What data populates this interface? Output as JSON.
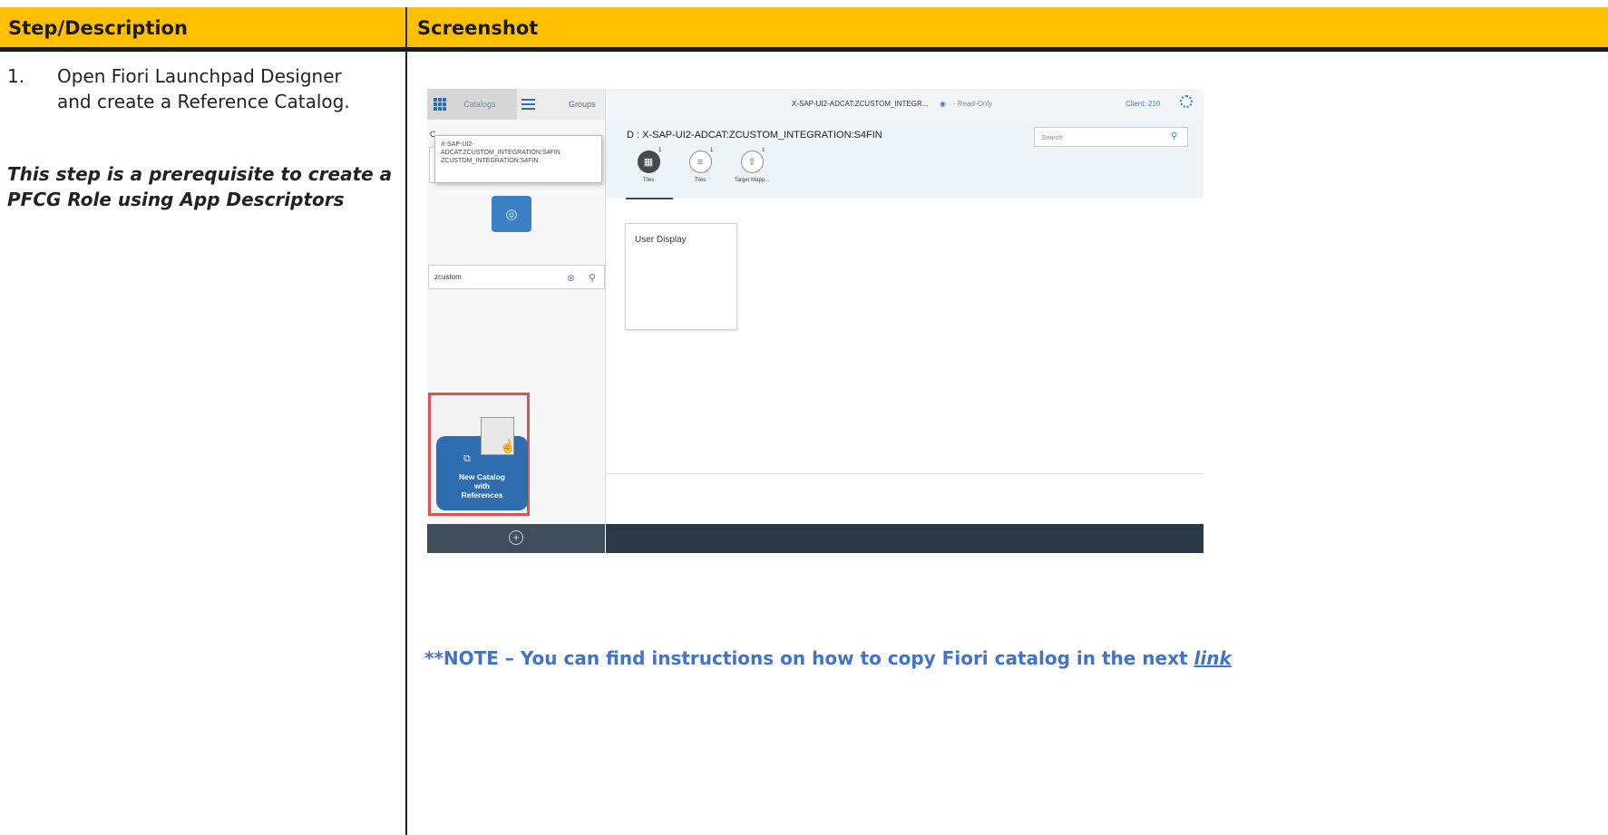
{
  "table": {
    "col1_header": "Step/Description",
    "col2_header": "Screenshot"
  },
  "step": {
    "number": "1.",
    "line1": "Open Fiori Launchpad Designer",
    "line2": "and create a Reference Catalog.",
    "prereq_line1": "This step is a prerequisite to create a",
    "prereq_line2": "PFCG Role using App Descriptors"
  },
  "note": {
    "text": "**NOTE – You can find instructions on how to copy Fiori catalog in the next ",
    "link_label": "link"
  },
  "screenshot": {
    "left_panel": {
      "catalogs_label": "Catalogs",
      "groups_label": "Groups",
      "c_label": "C",
      "tooltip_line1": "X-SAP-UI2-",
      "tooltip_line2": "ADCAT:ZCUSTOM_INTEGRATION:S4FIN",
      "tooltip_line3": "ZCUSTOM_INTEGRATION:S4FIN",
      "search_value": "zcustom",
      "new_catalog_label_1": "New Catalog",
      "new_catalog_label_2": "with",
      "new_catalog_label_3": "References"
    },
    "right_panel": {
      "title": "X-SAP-UI2-ADCAT:ZCUSTOM_INTEGR...",
      "read_only": "- Read-Only",
      "client": "Client: 210",
      "catalog_id": "D : X-SAP-UI2-ADCAT:ZCUSTOM_INTEGRATION:S4FIN",
      "search_placeholder": "Search",
      "tabs": [
        {
          "label": "Tiles",
          "count": "1"
        },
        {
          "label": "Tiles",
          "count": "1"
        },
        {
          "label": "Target Mapp...",
          "count": "1"
        }
      ],
      "tile_title": "User Display"
    }
  }
}
